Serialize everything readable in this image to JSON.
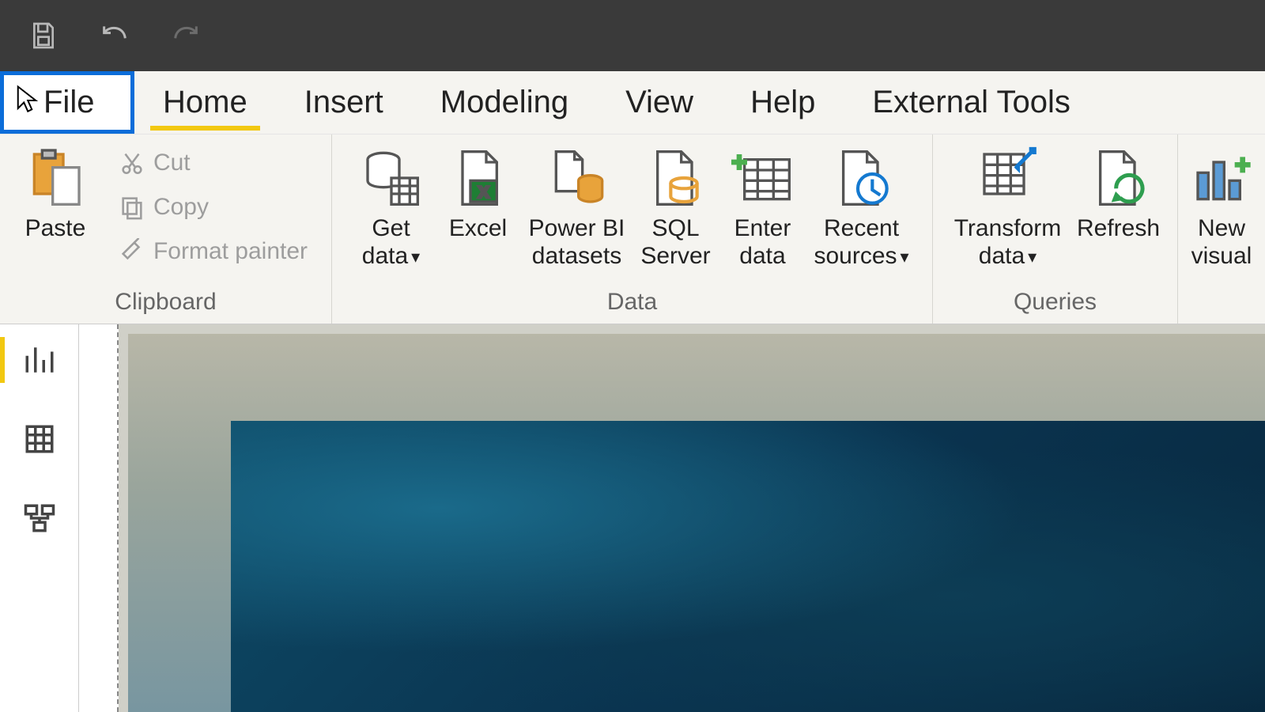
{
  "qa": {
    "save": "Save",
    "undo": "Undo",
    "redo": "Redo"
  },
  "tabs": {
    "file": "File",
    "items": [
      {
        "label": "Home",
        "active": true
      },
      {
        "label": "Insert",
        "active": false
      },
      {
        "label": "Modeling",
        "active": false
      },
      {
        "label": "View",
        "active": false
      },
      {
        "label": "Help",
        "active": false
      },
      {
        "label": "External Tools",
        "active": false
      }
    ]
  },
  "ribbon": {
    "clipboard": {
      "group_label": "Clipboard",
      "paste": "Paste",
      "cut": "Cut",
      "copy": "Copy",
      "format_painter": "Format painter"
    },
    "data": {
      "group_label": "Data",
      "get_data": "Get data",
      "excel": "Excel",
      "powerbi_datasets": "Power BI datasets",
      "sql_server": "SQL Server",
      "enter_data": "Enter data",
      "recent_sources": "Recent sources"
    },
    "queries": {
      "group_label": "Queries",
      "transform_data": "Transform data",
      "refresh": "Refresh"
    },
    "insert": {
      "new_visual": "New visual"
    }
  },
  "views": {
    "report": "Report view",
    "data": "Data view",
    "model": "Model view"
  }
}
